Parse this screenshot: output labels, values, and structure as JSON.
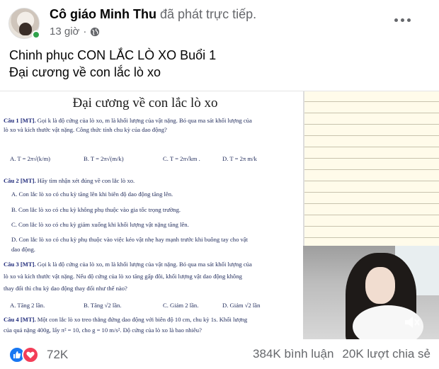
{
  "author": {
    "name": "Cô giáo Minh Thu",
    "action": "đã phát trực tiếp.",
    "time": "13 giờ",
    "separator": "·"
  },
  "post": {
    "line1": "Chinh phục CON LẮC LÒ XO Buổi 1",
    "line2": "Đại cương về con lắc lò xo"
  },
  "document": {
    "title": "Đại cương về con lắc lò xo",
    "q1": {
      "label": "Câu 1 [MT].",
      "text1": " Gọi k là độ cứng của lò xo, m là khối lượng của vật nặng. Bỏ qua ma sát khối lượng của",
      "text2": "lò xo và kích thước vật nặng. Công thức tính chu kỳ của dao động?",
      "opts": [
        "A. T = 2π√(k/m)",
        "B. T = 2π√(m/k)",
        "C. T = 2π√km .",
        "D. T = 2π m/k"
      ]
    },
    "q2": {
      "label": "Câu 2 [MT].",
      "text": " Hãy tìm nhận xét đúng về con lắc lò xo.",
      "a": "A. Con lắc lò xo có chu kỳ tăng lên khi biên độ dao động tăng lên.",
      "b": "B. Con lắc lò xo có chu kỳ không phụ thuộc vào gia tốc trọng trường.",
      "c": "C. Con lắc lò xo có chu kỳ giảm xuống khi khối lượng vật nặng tăng lên.",
      "d1": "D. Con lắc lò xo có chu kỳ phụ thuộc vào việc kéo vật nhẹ hay mạnh trước khi buông tay cho vật",
      "d2": "dao động."
    },
    "q3": {
      "label": "Câu 3 [MT].",
      "text1": " Gọi k là độ cứng của lò xo, m là khối lượng của vật nặng. Bỏ qua ma sát khối lượng của",
      "text2": "lò xo và kích thước vật nặng. Nếu độ cứng của lò xo tăng gấp đôi, khối lượng vật dao động không",
      "text3": "thay đổi thì chu kỳ dao động thay đổi như thế nào?",
      "opts": [
        "A. Tăng 2 lần.",
        "B. Tăng √2 lần.",
        "C. Giảm 2 lần.",
        "D. Giảm √2 lần"
      ]
    },
    "q4": {
      "label": "Câu 4 [MT].",
      "text1": " Một con lắc lò xo treo thẳng đứng dao động với biên độ 10 cm, chu kỳ 1s. Khối lượng",
      "text2": "của quả nặng 400g, lấy π² = 10, cho g = 10 m/s². Độ cứng của lò xo là bao nhiêu?"
    }
  },
  "footer": {
    "reaction_count": "72K",
    "comments": "384K bình luận",
    "shares": "20K lượt chia sẻ"
  },
  "icons": {
    "globe": "globe-icon",
    "more": "more-icon",
    "like": "like-icon",
    "love": "love-icon",
    "speaker": "speaker-muted-icon"
  },
  "colors": {
    "like": "#1877f2",
    "love": "#f33e58",
    "online": "#31a24c",
    "muted_text": "#65676b"
  }
}
